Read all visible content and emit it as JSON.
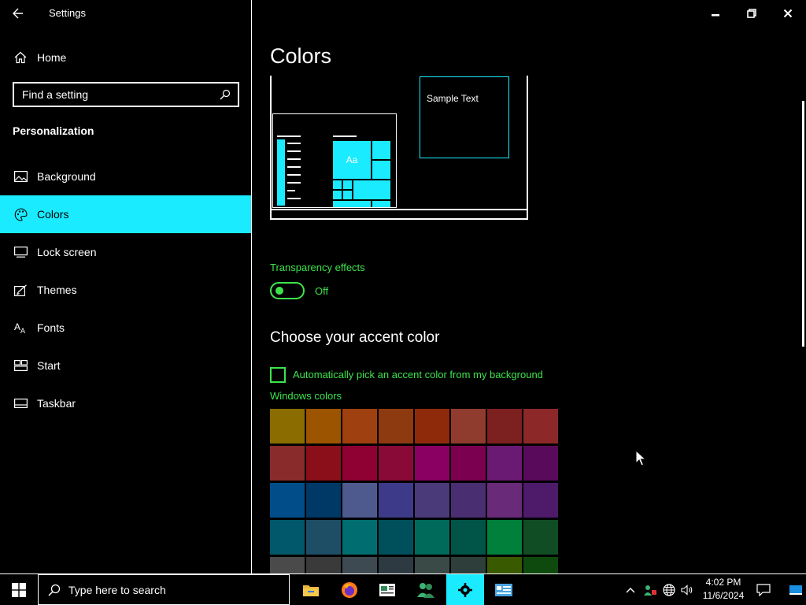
{
  "app": {
    "title": "Settings"
  },
  "nav": {
    "home_label": "Home",
    "search_placeholder": "Find a setting",
    "section_title": "Personalization",
    "items": [
      {
        "label": "Background",
        "icon": "image-icon",
        "active": false
      },
      {
        "label": "Colors",
        "icon": "palette-icon",
        "active": true
      },
      {
        "label": "Lock screen",
        "icon": "lock-screen-icon",
        "active": false
      },
      {
        "label": "Themes",
        "icon": "themes-icon",
        "active": false
      },
      {
        "label": "Fonts",
        "icon": "fonts-icon",
        "active": false
      },
      {
        "label": "Start",
        "icon": "start-icon",
        "active": false
      },
      {
        "label": "Taskbar",
        "icon": "taskbar-icon",
        "active": false
      }
    ]
  },
  "main": {
    "page_title": "Colors",
    "preview": {
      "sample_text": "Sample Text",
      "tile_text": "Aa"
    },
    "transparency": {
      "label": "Transparency effects",
      "state": "Off"
    },
    "accent_heading": "Choose your accent color",
    "auto_pick_label": "Automatically pick an accent color from my background",
    "windows_colors_label": "Windows colors",
    "swatches": [
      [
        "#8a6c00",
        "#9c5400",
        "#9e4010",
        "#8e3a10",
        "#8e2a0a",
        "#8f3b2e",
        "#7d2020",
        "#8c2828"
      ],
      [
        "#8a2b2b",
        "#8a0f1a",
        "#8f0033",
        "#8a0a37",
        "#8a0062",
        "#7c0050",
        "#6b1a73",
        "#5a0a5a"
      ],
      [
        "#004d8a",
        "#003866",
        "#4e5a8e",
        "#3e3a8a",
        "#4a3a7a",
        "#4a2e72",
        "#6a2a7a",
        "#4e1a6a"
      ],
      [
        "#00586a",
        "#1e4e66",
        "#006e70",
        "#00505c",
        "#006a5a",
        "#005448",
        "#00803a",
        "#104d24"
      ],
      [
        "#4a4a4a",
        "#3a3a3a",
        "#3e4a52",
        "#2e3a42",
        "#3a4a46",
        "#2e3e3a",
        "#3a5a00",
        "#0e4a0e"
      ]
    ],
    "accent_colors": {
      "highlight": "#1aebff",
      "text_green": "#3ce44c",
      "border": "#ffffff"
    }
  },
  "window_controls": {
    "minimize": "minimize-icon",
    "restore": "restore-icon",
    "close": "close-icon"
  },
  "taskbar": {
    "search_placeholder": "Type here to search",
    "apps": [
      "file-explorer-icon",
      "firefox-icon",
      "news-icon",
      "people-icon",
      "settings-gear-icon",
      "control-panel-icon"
    ],
    "time": "4:02 PM",
    "date": "11/6/2024"
  }
}
